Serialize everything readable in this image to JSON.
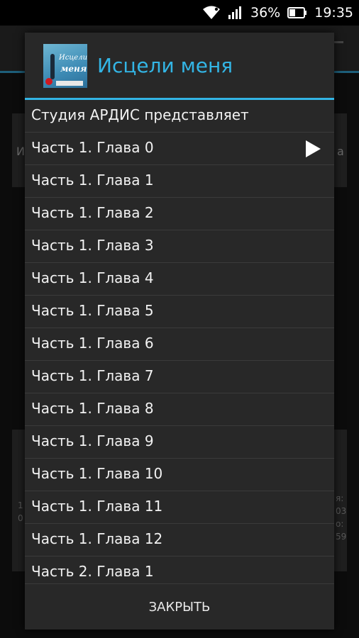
{
  "status_bar": {
    "battery_percent": "36%",
    "time": "19:35"
  },
  "background": {
    "card1_left_char": "И",
    "card1_right_char": "а",
    "card2_left_top": "1",
    "card2_left_bottom": "0",
    "card2_right_1": "я:",
    "card2_right_2": "03",
    "card2_right_3": "о:",
    "card2_right_4": "59"
  },
  "dialog": {
    "title": "Исцели меня",
    "icon_text_1": "Исцели",
    "icon_text_2": "меня",
    "items": [
      {
        "label": "Студия АРДИС представляет"
      },
      {
        "label": "Часть 1. Глава 0",
        "playing": true
      },
      {
        "label": "Часть 1. Глава 1"
      },
      {
        "label": "Часть 1. Глава 2"
      },
      {
        "label": "Часть 1. Глава 3"
      },
      {
        "label": "Часть 1. Глава 4"
      },
      {
        "label": "Часть 1. Глава 5"
      },
      {
        "label": "Часть 1. Глава 6"
      },
      {
        "label": "Часть 1. Глава 7"
      },
      {
        "label": "Часть 1. Глава 8"
      },
      {
        "label": "Часть 1. Глава 9"
      },
      {
        "label": "Часть 1. Глава 10"
      },
      {
        "label": "Часть 1. Глава 11"
      },
      {
        "label": "Часть 1. Глава 12"
      },
      {
        "label": "Часть 2. Глава 1"
      }
    ],
    "close_label": "ЗАКРЫТЬ"
  },
  "colors": {
    "accent": "#33b5e5",
    "dialog_bg": "#282828"
  }
}
